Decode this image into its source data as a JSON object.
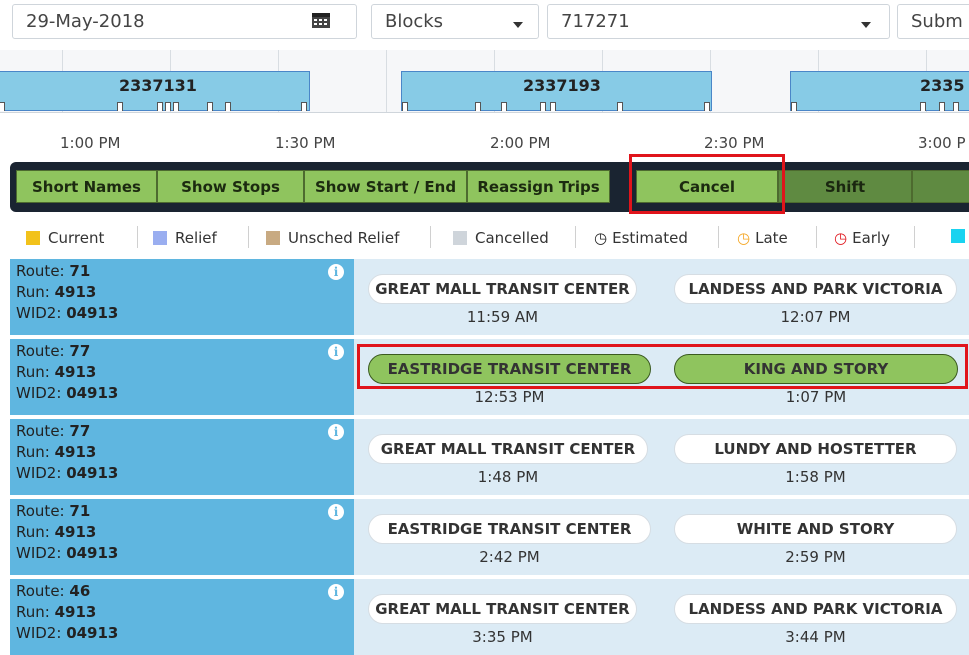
{
  "filters": {
    "date": "29-May-2018",
    "calendar_icon": "calendar-icon",
    "type": "Blocks",
    "block_id": "717271",
    "submit_label": "Subm"
  },
  "timeline": {
    "blocks": [
      "2337131",
      "2337193",
      "2335"
    ],
    "times": [
      "1:00 PM",
      "1:30 PM",
      "2:00 PM",
      "2:30 PM",
      "3:00 P"
    ]
  },
  "toolbar": {
    "short_names": "Short Names",
    "show_stops": "Show Stops",
    "show_start_end": "Show Start / End",
    "reassign_trips": "Reassign Trips",
    "cancel": "Cancel",
    "shift": "Shift"
  },
  "legend": {
    "current": "Current",
    "relief": "Relief",
    "unsched_relief": "Unsched Relief",
    "cancelled": "Cancelled",
    "estimated": "Estimated",
    "late": "Late",
    "early": "Early",
    "colors": {
      "current": "#f2c21b",
      "relief": "#9aaef0",
      "unsched_relief": "#c8aa82",
      "cancelled": "#cfd5db",
      "late": "#f5a623",
      "early": "#e0141b",
      "last": "#19d3f0"
    }
  },
  "labels": {
    "route": "Route:",
    "run": "Run:",
    "wid2": "WID2:"
  },
  "rows": [
    {
      "route": "71",
      "run": "4913",
      "wid2": "04913",
      "from": "GREAT MALL TRANSIT CENTER",
      "from_time": "11:59 AM",
      "to": "LANDESS AND PARK VICTORIA",
      "to_time": "12:07 PM"
    },
    {
      "route": "77",
      "run": "4913",
      "wid2": "04913",
      "from": "EASTRIDGE TRANSIT CENTER",
      "from_time": "12:53 PM",
      "to": "KING AND STORY",
      "to_time": "1:07 PM"
    },
    {
      "route": "77",
      "run": "4913",
      "wid2": "04913",
      "from": "GREAT MALL TRANSIT CENTER",
      "from_time": "1:48 PM",
      "to": "LUNDY AND HOSTETTER",
      "to_time": "1:58 PM"
    },
    {
      "route": "71",
      "run": "4913",
      "wid2": "04913",
      "from": "EASTRIDGE TRANSIT CENTER",
      "from_time": "2:42 PM",
      "to": "WHITE AND STORY",
      "to_time": "2:59 PM"
    },
    {
      "route": "46",
      "run": "4913",
      "wid2": "04913",
      "from": "GREAT MALL TRANSIT CENTER",
      "from_time": "3:35 PM",
      "to": "LANDESS AND PARK VICTORIA",
      "to_time": "3:44 PM"
    }
  ]
}
